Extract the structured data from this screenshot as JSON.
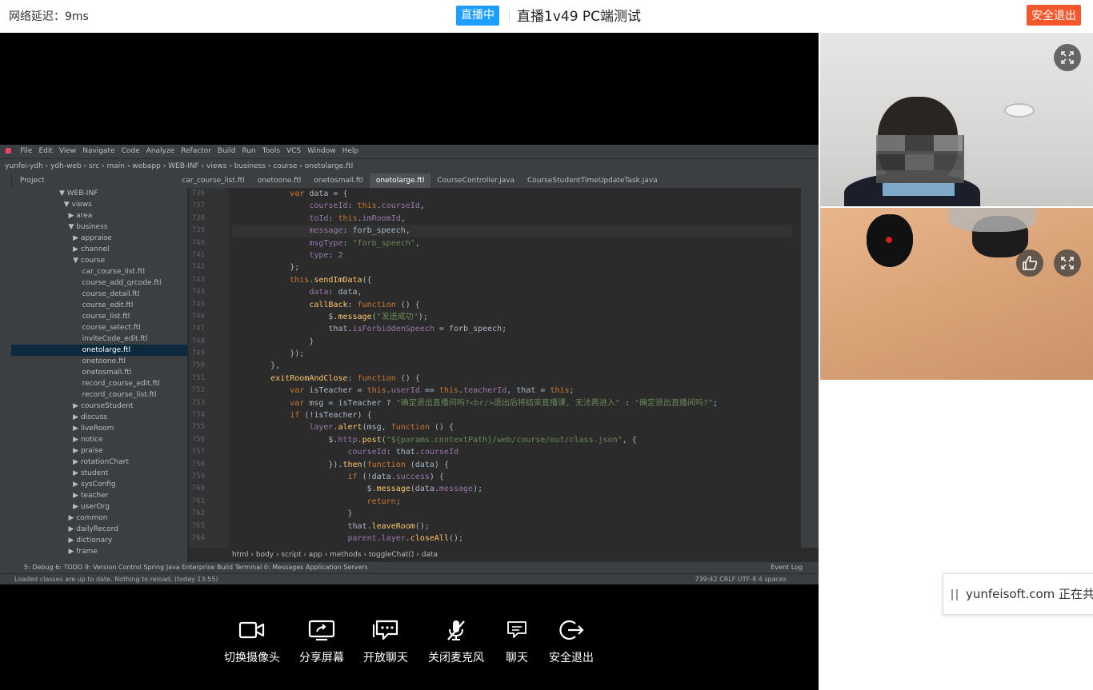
{
  "header": {
    "network_label": "网络延迟：9ms",
    "live_badge": "直播中",
    "room_title": "直播1v49 PC端测试",
    "exit_button": "安全退出"
  },
  "ide": {
    "menu": [
      "File",
      "Edit",
      "View",
      "Navigate",
      "Code",
      "Analyze",
      "Refactor",
      "Build",
      "Run",
      "Tools",
      "VCS",
      "Window",
      "Help"
    ],
    "nav_path": "yunfei-ydh › ydh-web › src › main › webapp › WEB-INF › views › business › course › onetolarge.ftl",
    "tabs": [
      "car_course_list.ftl",
      "onetoone.ftl",
      "onetosmall.ftl",
      "onetolarge.ftl",
      "CourseController.java",
      "CourseStudentTimeUpdateTask.java"
    ],
    "active_tab": "onetolarge.ftl",
    "project_label": "Project",
    "tree": [
      "▼ WEB-INF",
      "  ▼ views",
      "    ▶ area",
      "    ▼ business",
      "      ▶ appraise",
      "      ▶ channel",
      "      ▼ course",
      "          car_course_list.ftl",
      "          course_add_qrcode.ftl",
      "          course_detail.ftl",
      "          course_edit.ftl",
      "          course_list.ftl",
      "          course_select.ftl",
      "          inviteCode_edit.ftl",
      "          onetolarge.ftl",
      "          onetoone.ftl",
      "          onetosmall.ftl",
      "          record_course_edit.ftl",
      "          record_course_list.ftl",
      "      ▶ courseStudent",
      "      ▶ discuss",
      "      ▶ liveRoom",
      "      ▶ notice",
      "      ▶ praise",
      "      ▶ rotationChart",
      "      ▶ student",
      "      ▶ sysConfig",
      "      ▶ teacher",
      "      ▶ userOrg",
      "    ▶ common",
      "    ▶ dailyRecord",
      "    ▶ dictionary",
      "    ▶ frame"
    ],
    "selected_tree_item": "          onetolarge.ftl",
    "line_numbers": [
      "736",
      "737",
      "738",
      "739",
      "740",
      "741",
      "742",
      "743",
      "744",
      "745",
      "746",
      "747",
      "748",
      "749",
      "750",
      "751",
      "752",
      "753",
      "754",
      "755",
      "756",
      "757",
      "758",
      "759",
      "760",
      "761",
      "762",
      "763",
      "764"
    ],
    "breadcrumbs": "html  ›  body  ›  script  ›  app  ›  methods  ›  toggleChat()  ›  data",
    "toolwindows": "5: Debug    6: TODO    9: Version Control    Spring    Java Enterprise    Build    Terminal    0: Messages    Application Servers",
    "event_log": "Event Log",
    "status_left": "Loaded classes are up to date. Nothing to reload. (today 13:55)",
    "status_right": "739:42  CRLF  UTF-8  4 spaces"
  },
  "controls": [
    {
      "label": "切换摄像头",
      "icon": "camera-icon"
    },
    {
      "label": "分享屏幕",
      "icon": "share-screen-icon"
    },
    {
      "label": "开放聊天",
      "icon": "open-chat-icon"
    },
    {
      "label": "关闭麦克风",
      "icon": "mic-off-icon"
    },
    {
      "label": "聊天",
      "icon": "chat-icon"
    },
    {
      "label": "安全退出",
      "icon": "exit-icon"
    }
  ],
  "share_notice": "yunfeisoft.com 正在共享",
  "colors": {
    "live_badge": "#1e9fff",
    "exit_button": "#f5572c",
    "stage_bg": "#000000"
  }
}
